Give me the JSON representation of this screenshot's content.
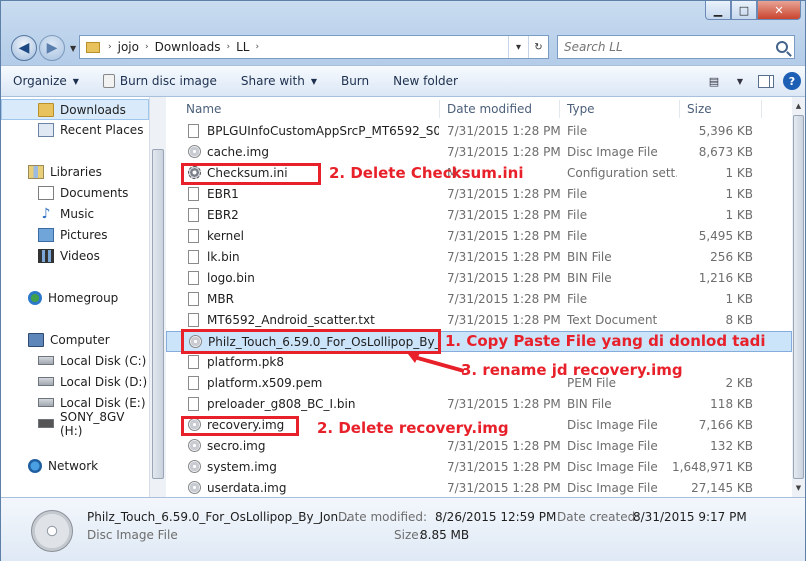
{
  "window": {
    "minimize_glyph": "▁",
    "maximize_glyph": "□",
    "close_glyph": "✕"
  },
  "address": {
    "back_glyph": "◀",
    "forward_glyph": "▶",
    "history_glyph": "▼",
    "prefix_sep": "›",
    "path": [
      "jojo",
      "Downloads",
      "LL"
    ],
    "dropdown_glyph": "▾",
    "refresh_glyph": "↻"
  },
  "search": {
    "placeholder": "Search LL"
  },
  "toolbar": {
    "organize": "Organize",
    "burn_disc_image": "Burn disc image",
    "share_with": "Share with",
    "burn": "Burn",
    "new_folder": "New folder",
    "dropdown_glyph": "▼",
    "help": "?",
    "views_glyph": "▤"
  },
  "sidebar": {
    "favorites": [
      {
        "label": "Downloads",
        "icon": "folder-icon"
      },
      {
        "label": "Recent Places",
        "icon": "recent-places-icon"
      }
    ],
    "libraries_label": "Libraries",
    "libraries": [
      {
        "label": "Documents",
        "icon": "documents-icon"
      },
      {
        "label": "Music",
        "icon": "music-icon"
      },
      {
        "label": "Pictures",
        "icon": "pictures-icon"
      },
      {
        "label": "Videos",
        "icon": "videos-icon"
      }
    ],
    "homegroup_label": "Homegroup",
    "computer_label": "Computer",
    "drives": [
      {
        "label": "Local Disk (C:)"
      },
      {
        "label": "Local Disk (D:)"
      },
      {
        "label": "Local Disk (E:)"
      },
      {
        "label": "SONY_8GV (H:)"
      }
    ],
    "network_label": "Network"
  },
  "columns": {
    "name": "Name",
    "date": "Date modified",
    "type": "Type",
    "size": "Size"
  },
  "files": [
    {
      "name": "BPLGUInfoCustomAppSrcP_MT6592_S00...",
      "date": "7/31/2015 1:28 PM",
      "type": "File",
      "size": "5,396 KB",
      "icon": "file"
    },
    {
      "name": "cache.img",
      "date": "7/31/2015 1:28 PM",
      "type": "Disc Image File",
      "size": "8,673 KB",
      "icon": "disc"
    },
    {
      "name": "Checksum.ini",
      "date": "M",
      "type": "Configuration sett...",
      "size": "1 KB",
      "icon": "gear"
    },
    {
      "name": "EBR1",
      "date": "7/31/2015 1:28 PM",
      "type": "File",
      "size": "1 KB",
      "icon": "file"
    },
    {
      "name": "EBR2",
      "date": "7/31/2015 1:28 PM",
      "type": "File",
      "size": "1 KB",
      "icon": "file"
    },
    {
      "name": "kernel",
      "date": "7/31/2015 1:28 PM",
      "type": "File",
      "size": "5,495 KB",
      "icon": "file"
    },
    {
      "name": "lk.bin",
      "date": "7/31/2015 1:28 PM",
      "type": "BIN File",
      "size": "256 KB",
      "icon": "file"
    },
    {
      "name": "logo.bin",
      "date": "7/31/2015 1:28 PM",
      "type": "BIN File",
      "size": "1,216 KB",
      "icon": "file"
    },
    {
      "name": "MBR",
      "date": "7/31/2015 1:28 PM",
      "type": "File",
      "size": "1 KB",
      "icon": "file"
    },
    {
      "name": "MT6592_Android_scatter.txt",
      "date": "7/31/2015 1:28 PM",
      "type": "Text Document",
      "size": "8 KB",
      "icon": "file"
    },
    {
      "name": "Philz_Touch_6.59.0_For_OsLollipop_By_Jo...",
      "date": "",
      "type": "",
      "size": "",
      "icon": "disc",
      "selected": true
    },
    {
      "name": "platform.pk8",
      "date": "",
      "type": "",
      "size": "",
      "icon": "file"
    },
    {
      "name": "platform.x509.pem",
      "date": "",
      "type": "PEM File",
      "size": "2 KB",
      "icon": "file"
    },
    {
      "name": "preloader_g808_BC_I.bin",
      "date": "7/31/2015 1:28 PM",
      "type": "BIN File",
      "size": "118 KB",
      "icon": "file"
    },
    {
      "name": "recovery.img",
      "date": "",
      "type": "Disc Image File",
      "size": "7,166 KB",
      "icon": "disc"
    },
    {
      "name": "secro.img",
      "date": "7/31/2015 1:28 PM",
      "type": "Disc Image File",
      "size": "132 KB",
      "icon": "disc"
    },
    {
      "name": "system.img",
      "date": "7/31/2015 1:28 PM",
      "type": "Disc Image File",
      "size": "1,648,971 KB",
      "icon": "disc"
    },
    {
      "name": "userdata.img",
      "date": "7/31/2015 1:28 PM",
      "type": "Disc Image File",
      "size": "27,145 KB",
      "icon": "disc"
    }
  ],
  "annotations": {
    "delete_checksum": "2. Delete Checksum.ini",
    "copy_paste": "1. Copy Paste File yang di donlod tadi",
    "rename": "3. rename jd recovery.img",
    "delete_recovery": "2. Delete recovery.img",
    "color": "#e8202a"
  },
  "details": {
    "filename": "Philz_Touch_6.59.0_For_OsLollipop_By_Jon...",
    "filetype": "Disc Image File",
    "modified_label": "Date modified:",
    "modified_value": "8/26/2015 12:59 PM",
    "created_label": "Date created:",
    "created_value": "8/31/2015 9:17 PM",
    "size_label": "Size:",
    "size_value": "8.85 MB"
  },
  "scroll": {
    "up_glyph": "▲",
    "down_glyph": "▼"
  }
}
